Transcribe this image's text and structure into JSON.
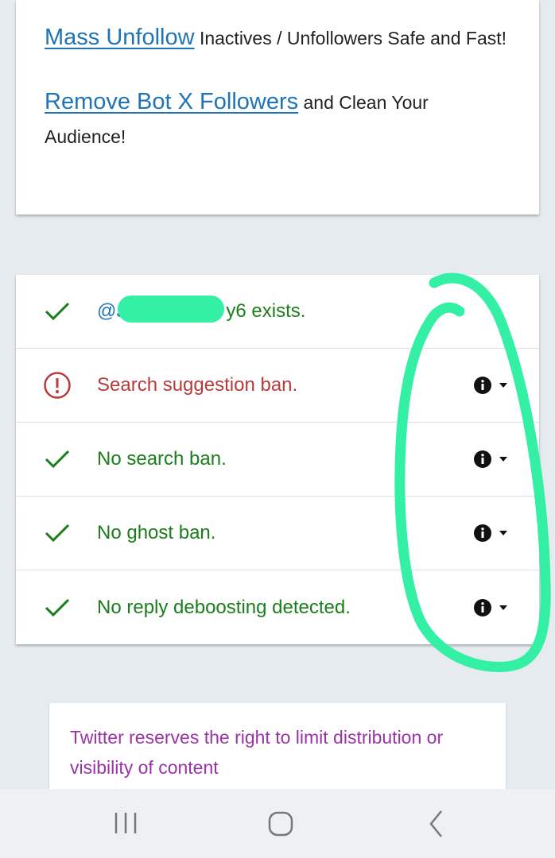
{
  "promo": {
    "line1": {
      "link": "Mass Unfollow",
      "text": " Inactives / Unfollowers Safe and Fast!"
    },
    "line2": {
      "link": "Remove Bot X Followers",
      "text": " and Clean Your Audience!"
    }
  },
  "results": {
    "rows": [
      {
        "status": "ok",
        "handle_prefix": "@J",
        "handle_suffix": "y6",
        "text": " exists.",
        "has_info": false
      },
      {
        "status": "error",
        "text": "Search suggestion ban.",
        "has_info": true
      },
      {
        "status": "ok",
        "text": "No search ban.",
        "has_info": true
      },
      {
        "status": "ok",
        "text": "No ghost ban.",
        "has_info": true
      },
      {
        "status": "ok",
        "text": "No reply deboosting detected.",
        "has_info": true
      }
    ]
  },
  "notice": {
    "text": "Twitter reserves the right to limit distribution or visibility of content"
  },
  "navbar": {
    "buttons": [
      "recent-apps-icon",
      "home-icon",
      "back-icon"
    ]
  },
  "colors": {
    "ok": "#1a7e1a",
    "error": "#b93a3a",
    "link": "#1f74b8",
    "notice": "#9b33a8",
    "annotation": "#34f0a5"
  }
}
